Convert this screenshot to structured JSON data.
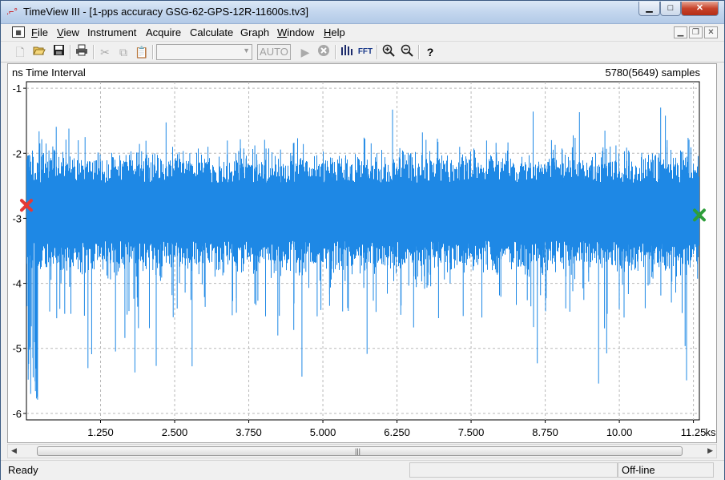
{
  "window": {
    "title": "TimeView III - [1-pps accuracy GSG-62-GPS-12R-11600s.tv3]",
    "controls": {
      "minimize": "▁",
      "maximize": "□",
      "close": "✕"
    }
  },
  "menu": {
    "items": [
      {
        "label": "File",
        "accel": "F"
      },
      {
        "label": "View",
        "accel": "V"
      },
      {
        "label": "Instrument",
        "accel": ""
      },
      {
        "label": "Acquire",
        "accel": ""
      },
      {
        "label": "Calculate",
        "accel": ""
      },
      {
        "label": "Graph",
        "accel": ""
      },
      {
        "label": "Window",
        "accel": "W"
      },
      {
        "label": "Help",
        "accel": "H"
      }
    ],
    "mdi_controls": {
      "minimize": "▁",
      "restore": "❐",
      "close": "✕"
    }
  },
  "toolbar": {
    "icons": [
      "new-file-icon",
      "open-folder-icon",
      "save-icon",
      "print-icon",
      "cut-icon",
      "copy-icon",
      "paste-icon",
      "play-icon",
      "stop-icon",
      "histogram-icon",
      "fft-icon",
      "zoom-in-icon",
      "zoom-out-icon",
      "help-icon"
    ],
    "auto_label": "AUTO",
    "fft_label": "FFT",
    "combo_value": ""
  },
  "plot": {
    "y_label": "ns Time Interval",
    "samples_label": "5780(5649) samples",
    "line_color": "#1e88e5",
    "start_marker_color": "#e53935",
    "end_marker_color": "#2e9e3a"
  },
  "chart_data": {
    "type": "line",
    "title": "",
    "ylabel": "ns Time Interval",
    "xlabel": "ks",
    "ylim": [
      -6.1,
      -0.9
    ],
    "xlim": [
      0,
      11.35
    ],
    "y_ticks": [
      "-1",
      "-2",
      "-3",
      "-4",
      "-5",
      "-6"
    ],
    "x_ticks": [
      "1.250",
      "2.500",
      "3.750",
      "5.000",
      "6.250",
      "7.500",
      "8.750",
      "10.00",
      "11.25"
    ],
    "x_unit": "ks",
    "grid": true,
    "series": [
      {
        "name": "",
        "band_center": -2.9,
        "band_low": -3.35,
        "band_high": -2.45,
        "min": -5.85,
        "max": -1.15,
        "n_samples": 5780
      }
    ],
    "markers": [
      {
        "x": 0,
        "y": -2.8,
        "color": "#e53935"
      },
      {
        "x": 11.35,
        "y": -2.95,
        "color": "#2e9e3a"
      }
    ]
  },
  "scrollbar": {
    "left_arrow": "◀",
    "right_arrow": "▶",
    "grip": "|||"
  },
  "status": {
    "ready": "Ready",
    "mode": "Off-line"
  }
}
